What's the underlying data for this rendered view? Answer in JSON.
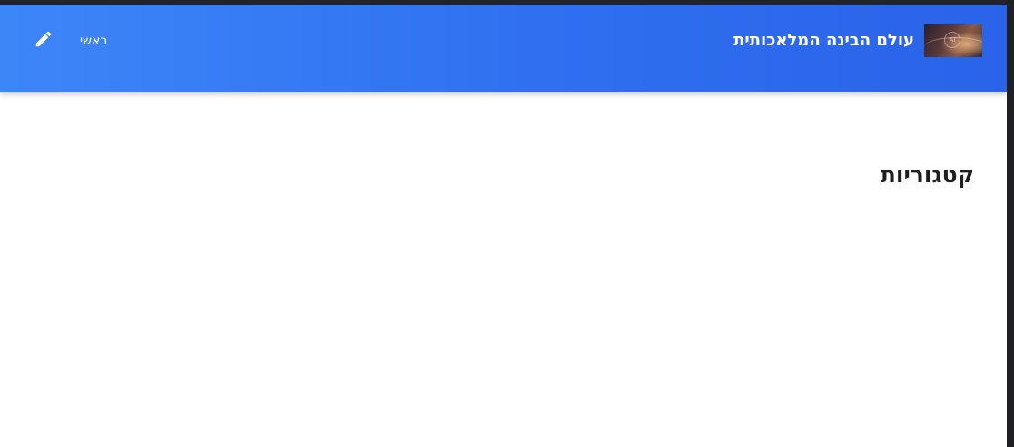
{
  "header": {
    "site_title": "עולם הבינה המלאכותית",
    "logo_text": "AI",
    "nav_home_label": "ראשי",
    "edit_icon": "pencil-icon",
    "background_color": "#3478f6"
  },
  "main": {
    "section_heading": "קטגוריות"
  }
}
